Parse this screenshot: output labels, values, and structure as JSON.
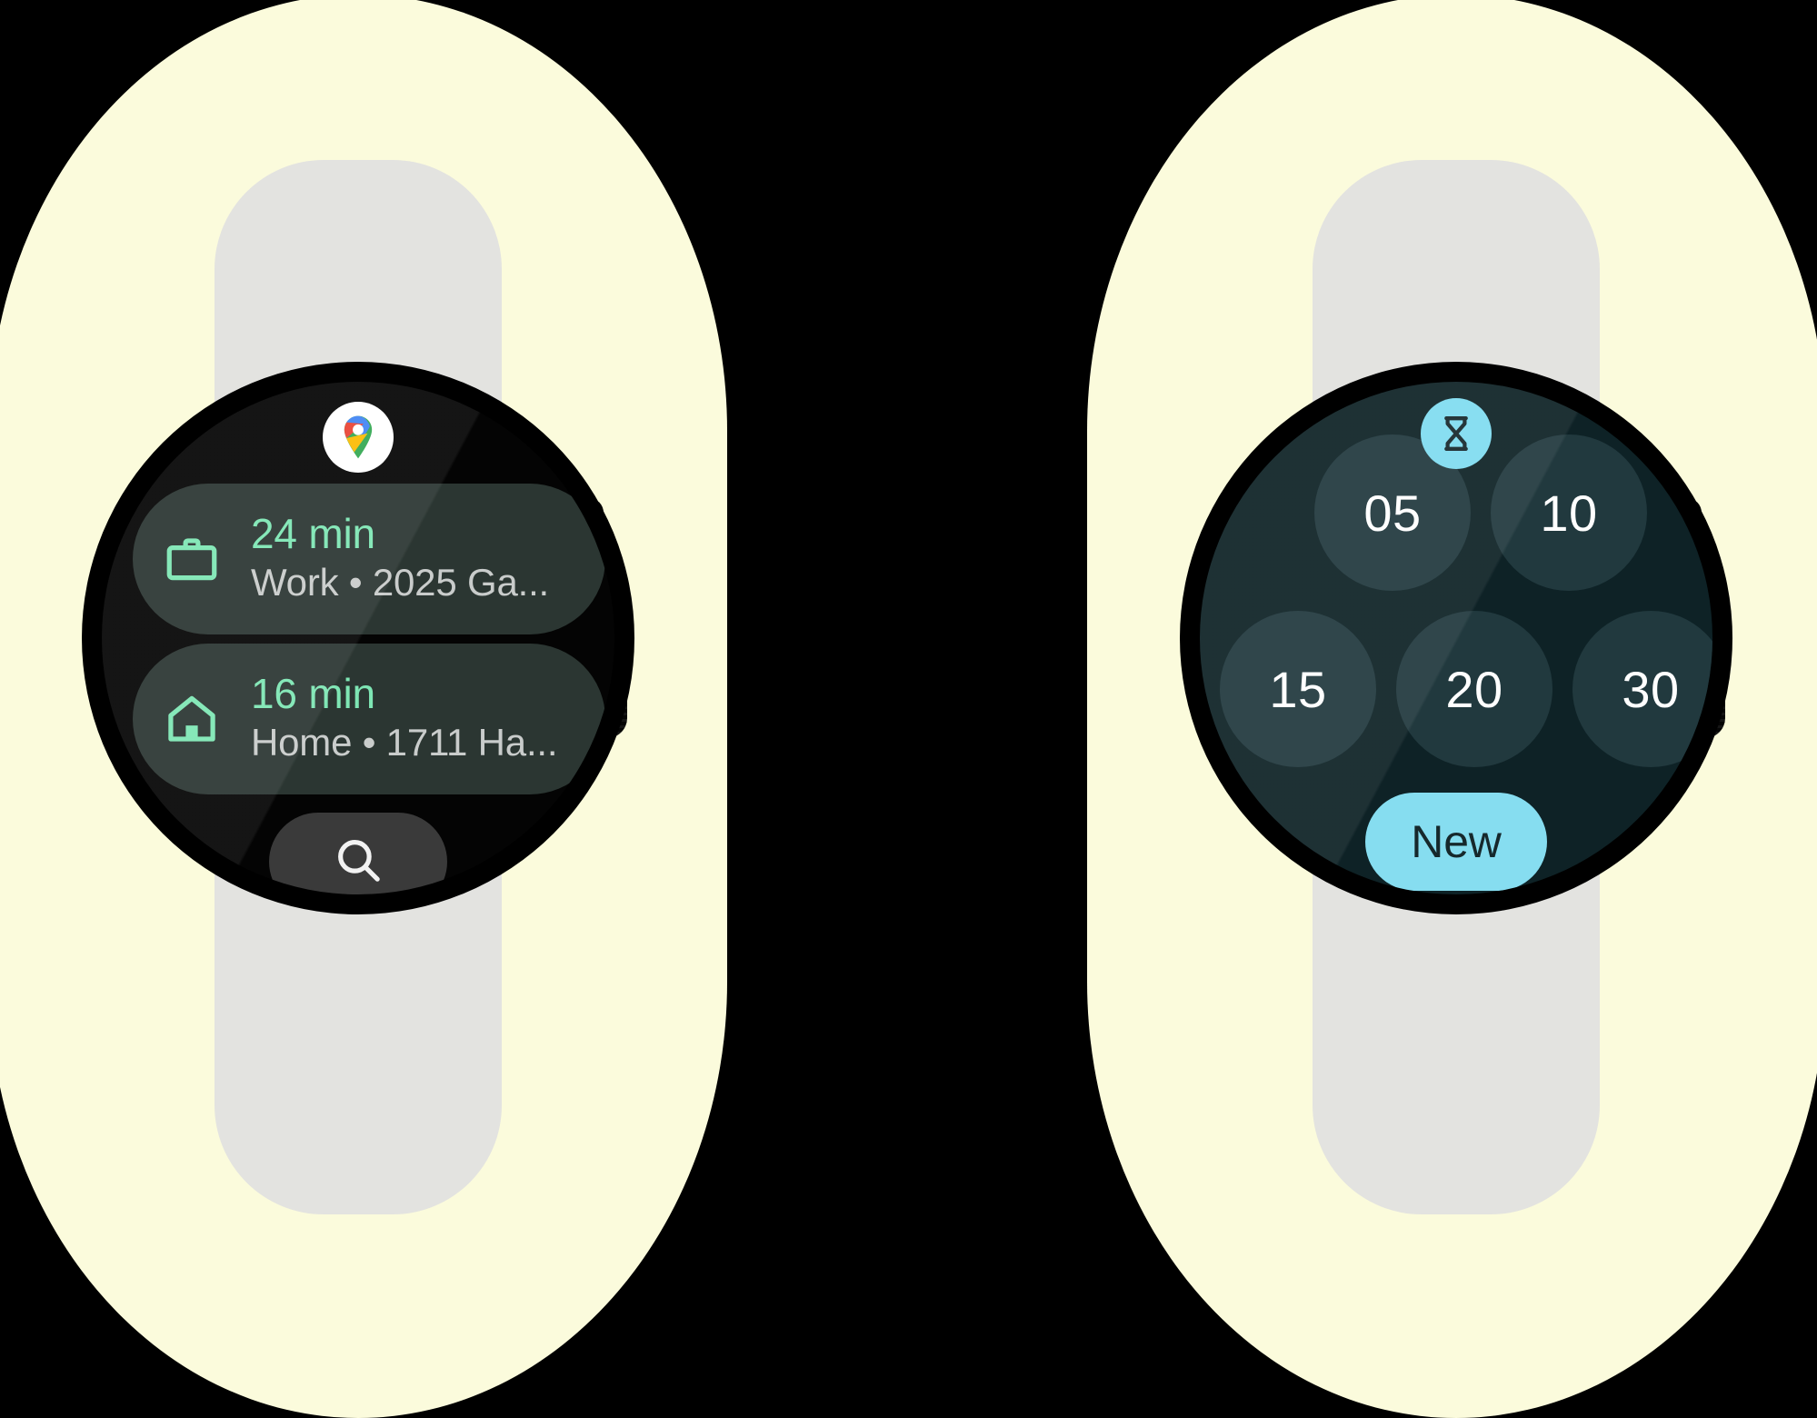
{
  "scene": {
    "background_color": "#000000",
    "blob_color": "#FBFBDC",
    "strap_color": "#E3E3E0",
    "case_color": "#000000"
  },
  "watch_left": {
    "app_name": "Google Maps",
    "app_icon": "google-maps-pin-icon",
    "screen_background": "#040404",
    "card_background": "#2B3632",
    "accent_color": "#7EE6B4",
    "routes": [
      {
        "icon": "briefcase-icon",
        "time": "24 min",
        "destination": "Work • 2025 Ga..."
      },
      {
        "icon": "home-icon",
        "time": "16 min",
        "destination": "Home • 1711 Ha..."
      }
    ],
    "search_button": {
      "icon": "search-icon",
      "label": "",
      "background": "#3A3A3A"
    }
  },
  "watch_right": {
    "app_name": "Timer",
    "app_icon": "hourglass-icon",
    "badge_color": "#7FDCF0",
    "screen_background": "#0E2226",
    "chip_background": "#21393E",
    "accent_color": "#86DDF0",
    "presets": [
      {
        "label": "05"
      },
      {
        "label": "10"
      },
      {
        "label": "15"
      },
      {
        "label": "20"
      },
      {
        "label": "30"
      }
    ],
    "new_button": {
      "label": "New",
      "background": "#86DDF0",
      "text_color": "#16282C"
    }
  }
}
